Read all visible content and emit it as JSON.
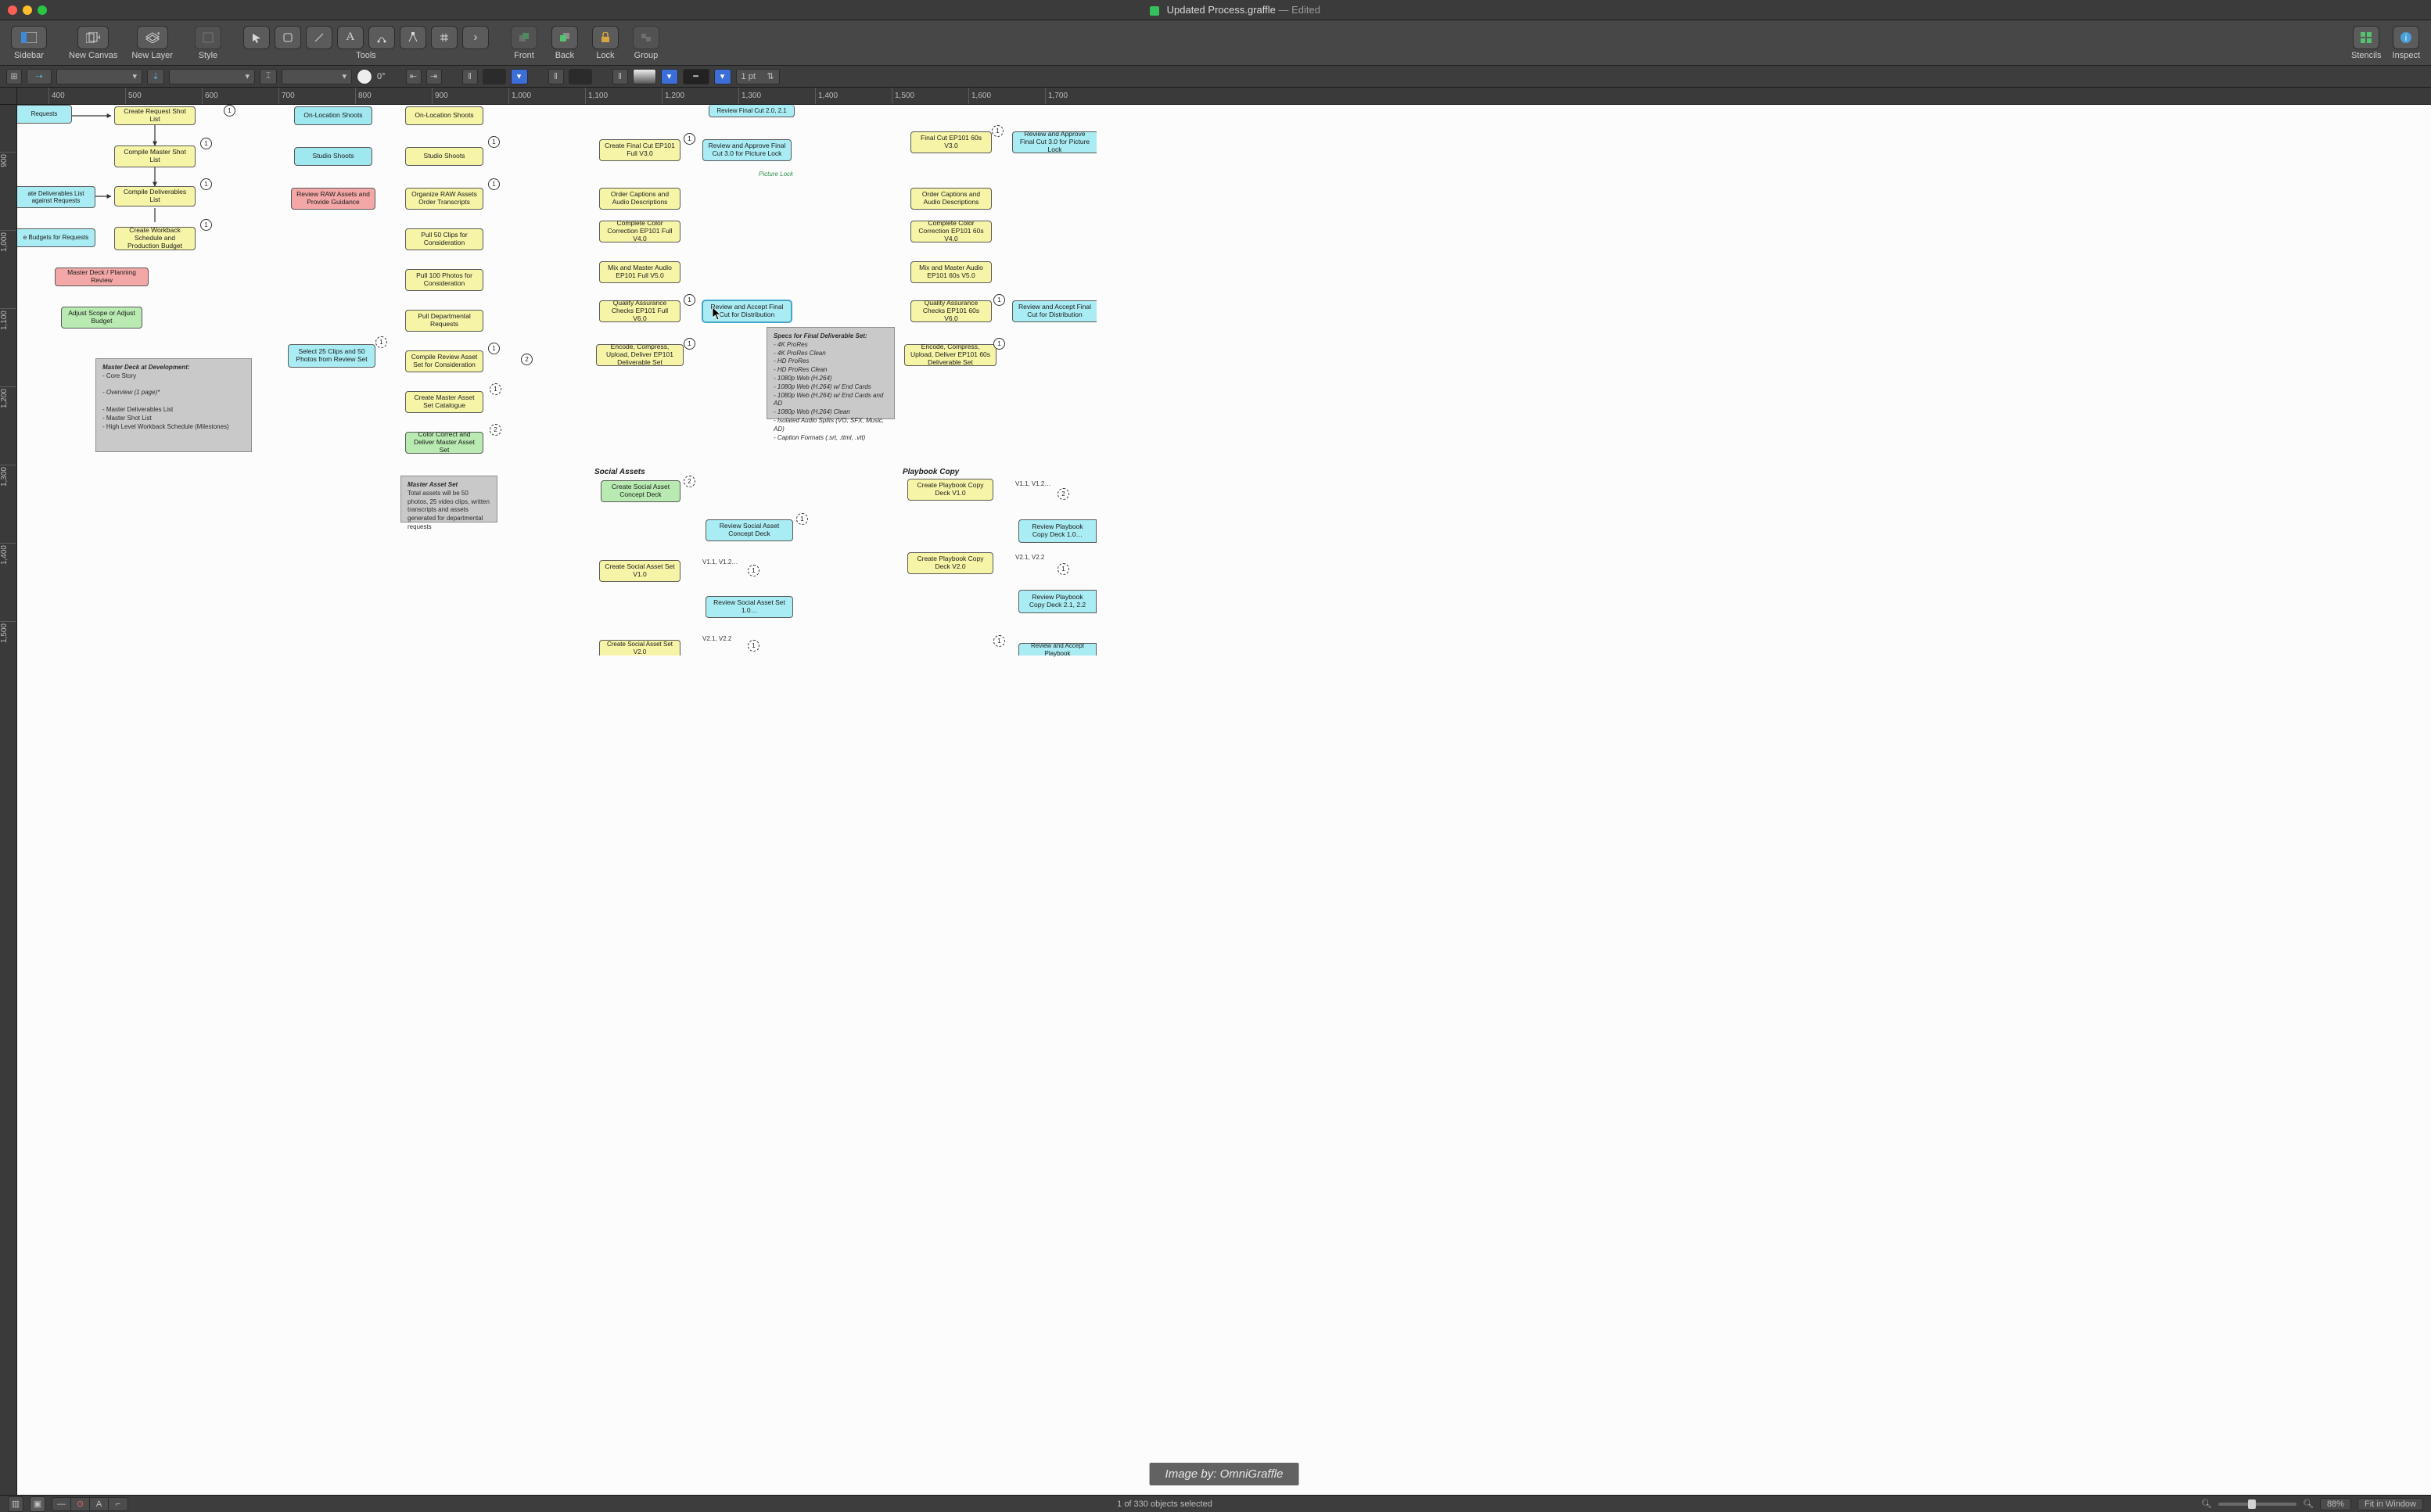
{
  "title_bar": {
    "filename": "Updated Process.graffle",
    "state": "— Edited"
  },
  "toolbar": {
    "sidebar": "Sidebar",
    "new_canvas": "New Canvas",
    "new_layer": "New Layer",
    "style": "Style",
    "tools": "Tools",
    "front": "Front",
    "back": "Back",
    "lock": "Lock",
    "group": "Group",
    "stencils": "Stencils",
    "inspect": "Inspect"
  },
  "format_bar": {
    "rotation_readout": "0°",
    "stroke_weight": "1 pt"
  },
  "ruler": {
    "h_ticks": [
      400,
      500,
      600,
      700,
      800,
      900,
      "1,000",
      "1,100",
      "1,200",
      "1,300",
      "1,400",
      "1,500",
      "1,600",
      "1,700"
    ],
    "v_ticks": [
      900,
      "1,000",
      "1,100",
      "1,200",
      "1,300",
      "1,400",
      "1,500"
    ]
  },
  "status": {
    "selection": "1 of 330 objects selected",
    "zoom": "88%",
    "fit": "Fit in Window"
  },
  "attribution": "Image by: OmniGraffle",
  "sections": {
    "social": "Social Assets",
    "playbook": "Playbook Copy"
  },
  "edge_labels": {
    "picture_lock": "Picture Lock",
    "v11_v12_a": "V1.1, V1.2…",
    "v11_v12_b": "V1.1, V1.2…",
    "v21_v22_a": "V2.1, V2.2",
    "v21_v22_b": "V2.1, V2.2"
  },
  "notes": {
    "master_deck": {
      "heading": "Master Deck at Development:",
      "lines": [
        "- Core Story",
        "",
        "- Overview (1 page)*",
        "",
        "- Master Deliverables List",
        "- Master Shot List",
        "- High Level Workback Schedule (Milestones)"
      ]
    },
    "master_asset": {
      "heading": "Master Asset Set",
      "body": "Total assets will be 50 photos, 25 video clips, written transcripts and assets generated for departmental requests"
    },
    "specs": {
      "heading": "Specs for Final Deliverable Set:",
      "lines": [
        "- 4K ProRes",
        "- 4K ProRes Clean",
        "- HD ProRes",
        "- HD ProRes Clean",
        "- 1080p Web (H.264)",
        "- 1080p Web (H.264) w/ End Cards",
        "- 1080p Web (H.264) w/ End Cards and AD",
        "- 1080p Web (H.264) Clean",
        "- Isolated Audio Splits (VO, SFX, Music, AD)",
        "- Caption Formats (.srt, .ttml, .vtt)"
      ]
    }
  },
  "nodes": {
    "n_requests": "Requests",
    "n_create_req": "Create Request Shot List",
    "n_comp_master": "Compile Master Shot List",
    "n_deliv_list": "ate Deliverables List against Requests",
    "n_comp_deliv": "Compile Deliverables List",
    "n_budgets": "e Budgets for Requests",
    "n_workback": "Create Workback Schedule and Production Budget",
    "n_planreview": "Master Deck / Planning Review",
    "n_adjust": "Adjust Scope or Adjust Budget",
    "n_onloc_b": "On-Location Shoots",
    "n_onloc_y": "On-Location Shoots",
    "n_studio_b": "Studio Shoots",
    "n_studio_y": "Studio Shoots",
    "n_raw_review": "Review RAW Assets and Provide Guidance",
    "n_raw_org": "Organize RAW Assets Order Transcripts",
    "n_50clips": "Pull 50 Clips for Consideration",
    "n_100photos": "Pull 100 Photos for Consideration",
    "n_dept_req": "Pull Departmental Requests",
    "n_sel25": "Select 25 Clips and 50 Photos from Review Set",
    "n_compile_set": "Compile Review Asset Set for Consideration",
    "n_cat_master": "Create Master Asset Set Catalogue",
    "n_cc_deliver": "Color Correct and Deliver Master Asset Set",
    "n_review_fc2": "Review Final Cut 2.0, 2.1",
    "n_create_fc3": "Create Final Cut EP101 Full V3.0",
    "n_review_fc3": "Review and Approve Final Cut 3.0 for Picture Lock",
    "n_order_cap": "Order Captions and Audio Descriptions",
    "n_color_v4": "Complete Color Correction EP101 Full V4.0",
    "n_mix_v5": "Mix and Master Audio EP101 Full V5.0",
    "n_qa_v6": "Quality Assurance Checks EP101 Full V6.0",
    "n_accept_fc": "Review and Accept Final Cut for Distribution",
    "n_encode": "Encode, Compress, Upload, Deliver EP101 Deliverable Set",
    "n_fc60_v3": "Final Cut EP101 60s V3.0",
    "n_review_fc60": "Review and Approve Final Cut 3.0 for Picture Lock",
    "n_order_cap60": "Order Captions and Audio Descriptions",
    "n_color60_v4": "Complete Color Correction EP101 60s V4.0",
    "n_mix60_v5": "Mix and Master Audio EP101 60s V5.0",
    "n_qa60_v6": "Quality Assurance Checks EP101 60s V6.0",
    "n_accept_fc60": "Review and Accept Final Cut for Distribution",
    "n_encode60": "Encode, Compress, Upload, Deliver EP101 60s Deliverable Set",
    "n_social_conc": "Create Social Asset Concept Deck",
    "n_social_rev": "Review Social Asset Concept Deck",
    "n_social_v1": "Create Social Asset Set V1.0",
    "n_social_rev1": "Review Social Asset Set 1.0…",
    "n_social_v2": "Create Social Asset Set V2.0",
    "n_play_v1": "Create Playbook Copy Deck V1.0",
    "n_play_rev1": "Review Playbook Copy Deck 1.0…",
    "n_play_v2": "Create Playbook Copy Deck V2.0",
    "n_play_rev2": "Review Playbook Copy Deck 2.1, 2.2",
    "n_play_acc": "Review and Accept Playbook"
  }
}
